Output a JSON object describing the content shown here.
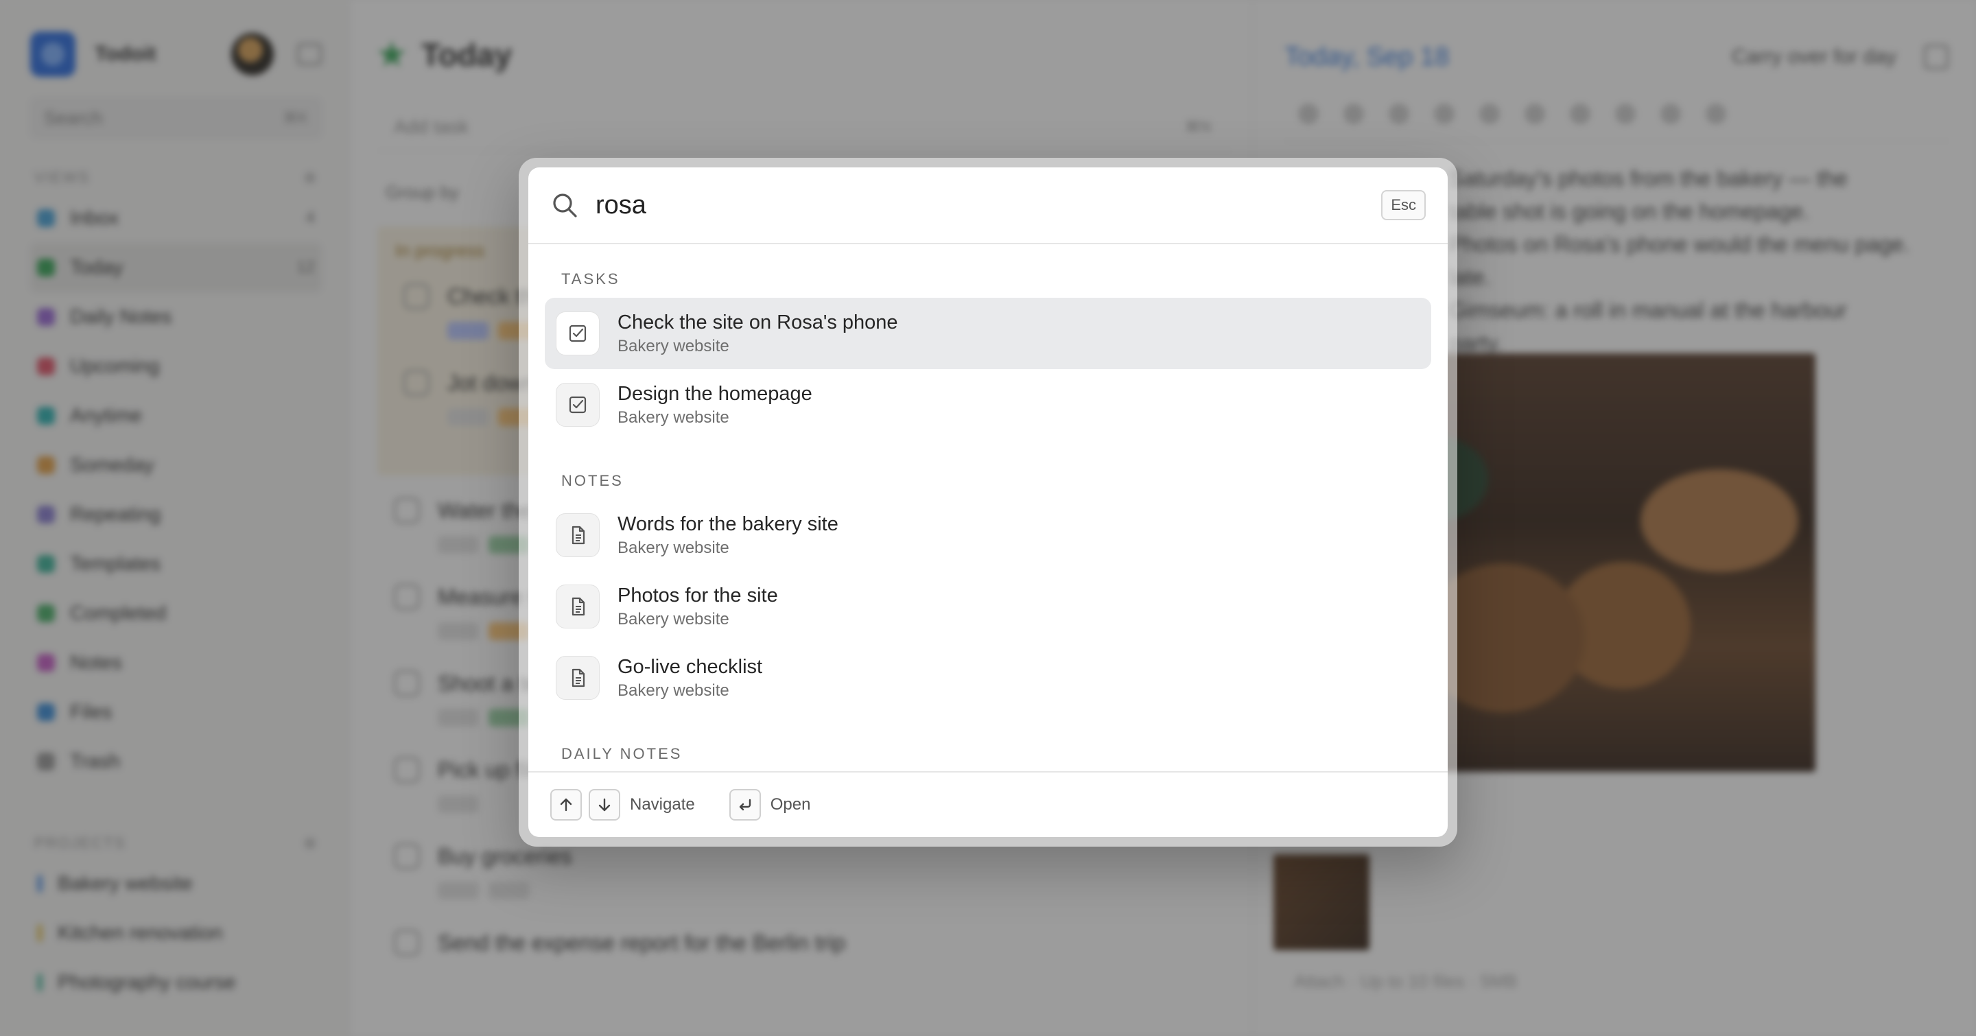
{
  "background": {
    "sidebar": {
      "brand": "Todoit",
      "search_placeholder": "Search",
      "search_shortcut": "⌘K",
      "views_label": "VIEWS",
      "items": [
        {
          "label": "Inbox",
          "count": "4",
          "color": "#4aa3d8"
        },
        {
          "label": "Today",
          "count": "12",
          "color": "#3aa65a"
        },
        {
          "label": "Daily Notes",
          "count": "",
          "color": "#9b6bd6"
        },
        {
          "label": "Upcoming",
          "count": "",
          "color": "#e0566b"
        },
        {
          "label": "Anytime",
          "count": "",
          "color": "#2fb3b3"
        },
        {
          "label": "Someday",
          "count": "",
          "color": "#e3a14a"
        },
        {
          "label": "Repeating",
          "count": "",
          "color": "#8a7fd1"
        },
        {
          "label": "Templates",
          "count": "",
          "color": "#3fb39a"
        },
        {
          "label": "Completed",
          "count": "",
          "color": "#4caf6a"
        },
        {
          "label": "Notes",
          "count": "",
          "color": "#c65fc6"
        },
        {
          "label": "Files",
          "count": "",
          "color": "#3e8fd9"
        },
        {
          "label": "Trash",
          "count": "",
          "color": "#9a9a9a"
        }
      ],
      "projects_label": "PROJECTS",
      "projects": [
        {
          "label": "Bakery website",
          "color": "#6aa0e8"
        },
        {
          "label": "Kitchen renovation",
          "color": "#e6c96a"
        },
        {
          "label": "Photography course",
          "color": "#5fc0a8"
        }
      ]
    },
    "main": {
      "title": "Today",
      "add_task": "Add task",
      "add_task_shortcut": "⌘N",
      "filter": "Group by",
      "in_progress": "In progress",
      "tasks": [
        "Check the site on Rosa's phone",
        "Jot down ideas",
        "Water the plants",
        "Measure the kitchen",
        "Shoot a test roll",
        "Pick up film",
        "Buy groceries",
        "Send the expense report for the Berlin trip"
      ]
    },
    "detail": {
      "date": "Today, Sep 18",
      "carry": "Carry over for day",
      "text_lines": [
        "Saturday's photos from the bakery — the",
        "table shot is going on the homepage.",
        "Photos on Rosa's phone would the menu page.",
        "late.",
        "Gimseum: a roll in manual at the harbour",
        "party."
      ],
      "footer": "Attach · Up to 10 files · 5MB"
    }
  },
  "palette": {
    "query": "rosa",
    "esc_label": "Esc",
    "groups": [
      {
        "label": "TASKS",
        "results": [
          {
            "title": "Check the site on Rosa's phone",
            "subtitle": "Bakery website",
            "icon": "checkbox-icon",
            "selected": true
          },
          {
            "title": "Design the homepage",
            "subtitle": "Bakery website",
            "icon": "checkbox-icon",
            "selected": false
          }
        ]
      },
      {
        "label": "NOTES",
        "results": [
          {
            "title": "Words for the bakery site",
            "subtitle": "Bakery website",
            "icon": "document-icon",
            "selected": false
          },
          {
            "title": "Photos for the site",
            "subtitle": "Bakery website",
            "icon": "document-icon",
            "selected": false
          },
          {
            "title": "Go-live checklist",
            "subtitle": "Bakery website",
            "icon": "document-icon",
            "selected": false
          }
        ]
      },
      {
        "label": "DAILY NOTES",
        "results": []
      }
    ],
    "footer": {
      "navigate_label": "Navigate",
      "open_label": "Open"
    }
  }
}
